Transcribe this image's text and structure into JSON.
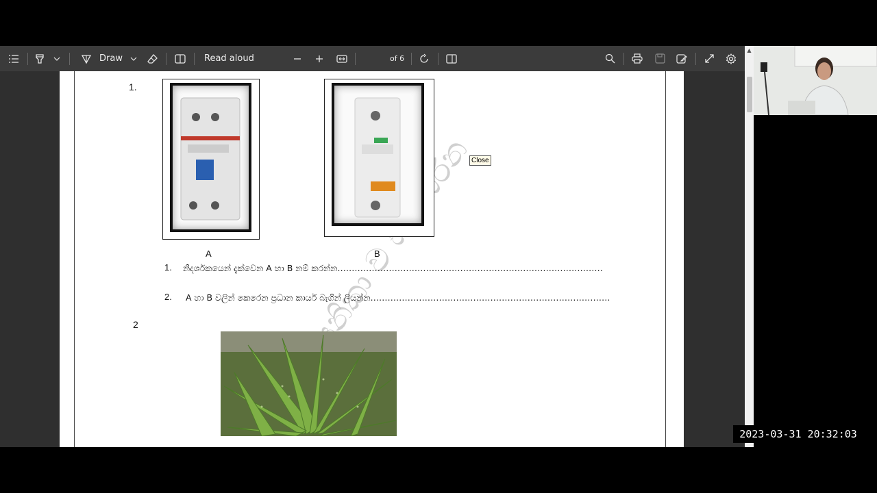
{
  "toolbar": {
    "draw_label": "Draw",
    "read_aloud_label": "Read aloud",
    "page_number": "1",
    "page_total": "of 6"
  },
  "tooltip": {
    "text": "Close"
  },
  "document": {
    "q1_number": "1.",
    "image_a_label": "A",
    "image_b_label": "B",
    "sub1_number": "1.",
    "sub1_text": "නිදර්ශකයෙන් දැක්වෙන  A   හා  B     නම් කරන්න…………………………………………………………………………………",
    "sub2_number": "2.",
    "sub2_text": "A හා B වලින් කෙරෙන ප්‍රධාන කාර්ය බැගින් ලියන්න…………………………………………………………………………",
    "q2_number": "2"
  },
  "watermark": {
    "text": "ආසනිකා ව සංවර්ධන"
  },
  "overlay": {
    "timestamp": "2023-03-31  20:32:03"
  },
  "icons": [
    "contents-icon",
    "highlight-icon",
    "chevron-down-icon",
    "draw-icon",
    "eraser-icon",
    "page-view-icon",
    "zoom-out-icon",
    "zoom-in-icon",
    "fit-width-icon",
    "rotate-icon",
    "two-page-icon",
    "search-icon",
    "print-icon",
    "save-icon",
    "save-as-icon",
    "fullscreen-icon",
    "settings-icon"
  ]
}
